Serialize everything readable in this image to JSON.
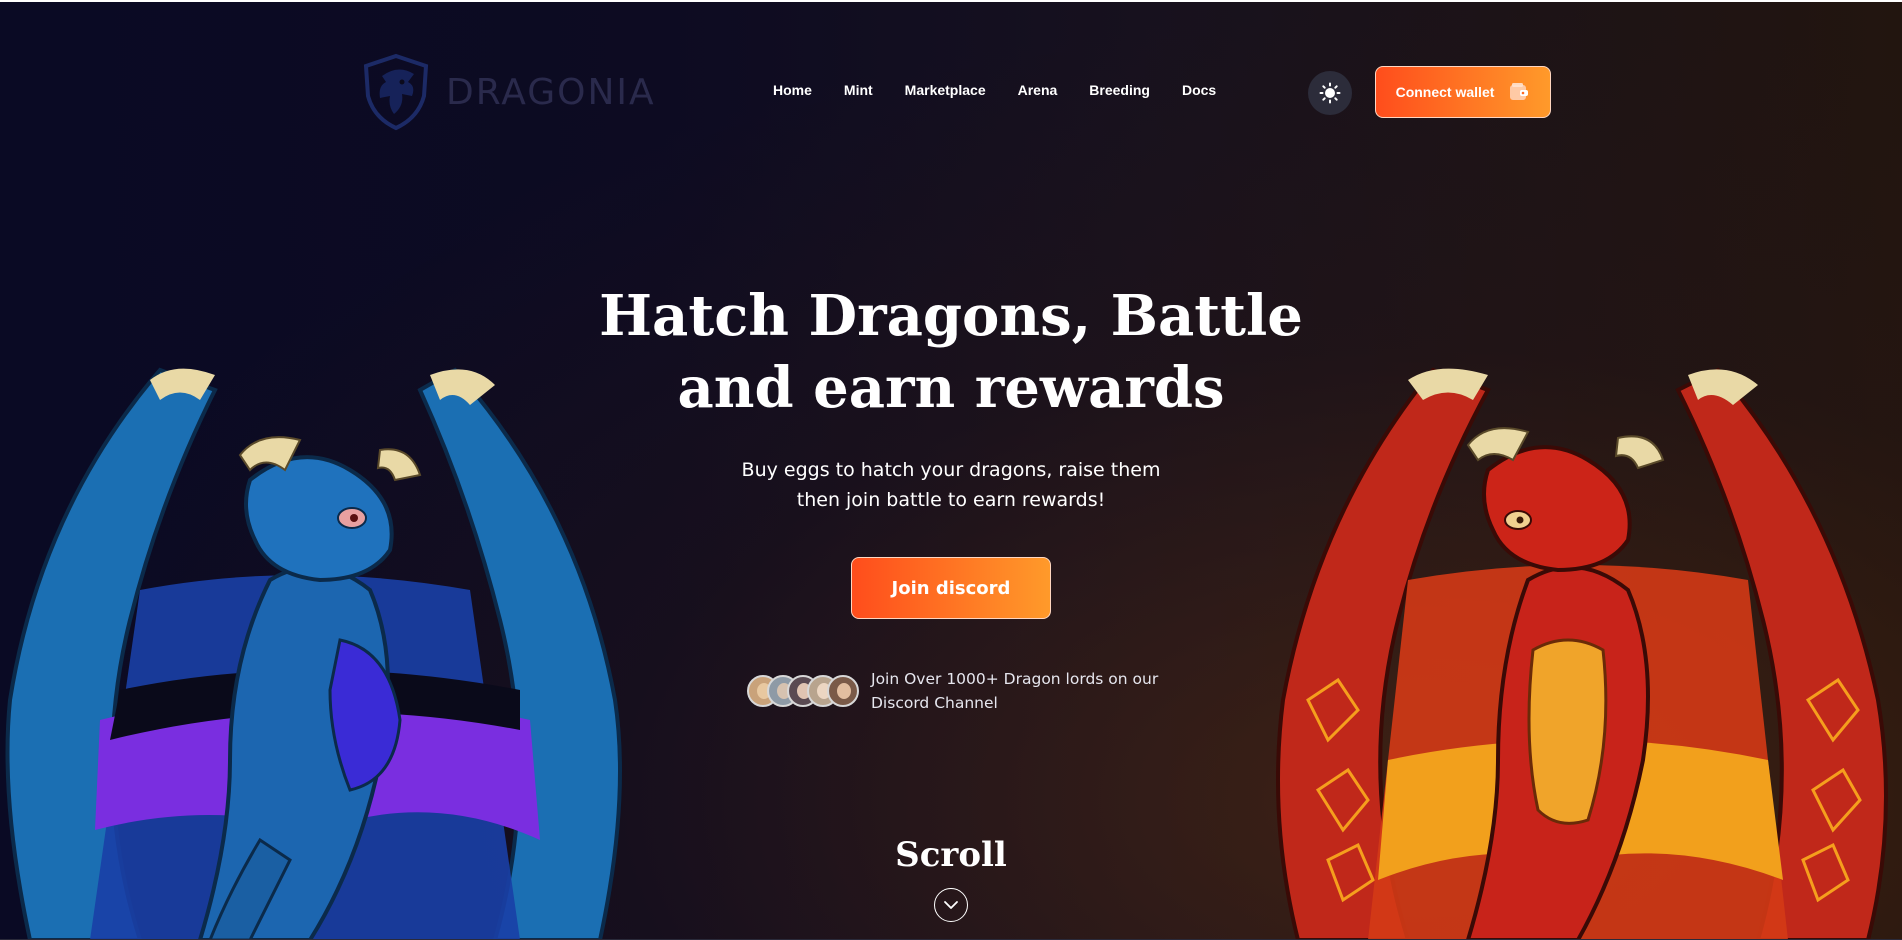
{
  "brand": {
    "name": "DRAGONIA",
    "logo_icon": "dragon-head-shield-icon"
  },
  "nav": {
    "items": [
      {
        "label": "Home"
      },
      {
        "label": "Mint"
      },
      {
        "label": "Marketplace"
      },
      {
        "label": "Arena"
      },
      {
        "label": "Breeding"
      },
      {
        "label": "Docs"
      }
    ]
  },
  "header": {
    "theme_toggle_icon": "sun-icon",
    "connect_wallet_label": "Connect wallet",
    "connect_wallet_icon": "wallet-icon"
  },
  "hero": {
    "title_line1": "Hatch Dragons, Battle",
    "title_line2": "and earn rewards",
    "subtitle_line1": "Buy eggs to hatch your dragons, raise them",
    "subtitle_line2": "then join battle to earn rewards!",
    "cta_label": "Join discord",
    "community_line1": "Join Over 1000+ Dragon lords on our",
    "community_line2": "Discord Channel",
    "avatar_count": 5,
    "scroll_label": "Scroll",
    "scroll_icon": "chevron-down-icon"
  },
  "colors": {
    "accent_start": "#ff4d1c",
    "accent_end": "#ff9a2a",
    "background": "#0b0a1c",
    "blue_dragon": "#1f6fb8",
    "red_dragon": "#c82216"
  }
}
